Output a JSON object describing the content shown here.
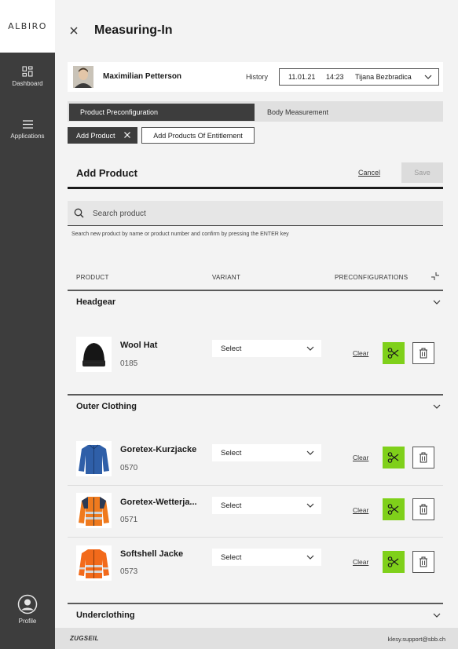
{
  "app": {
    "logo": "ALBIRO"
  },
  "sidebar": {
    "items": [
      {
        "label": "Dashboard",
        "icon": "dashboard-icon"
      },
      {
        "label": "Applications",
        "icon": "menu-icon"
      }
    ],
    "profile": {
      "label": "Profile",
      "icon": "profile-icon"
    }
  },
  "header": {
    "title": "Measuring-In",
    "close_icon": "close-icon"
  },
  "person": {
    "name": "Maximilian Petterson",
    "history_label": "History",
    "history": {
      "date": "11.01.21",
      "time": "14:23",
      "user": "Tijana Bezbradica"
    }
  },
  "tabs": [
    {
      "label": "Product Preconfiguration",
      "active": true
    },
    {
      "label": "Body Measurement",
      "active": false
    }
  ],
  "chips": {
    "add_product": "Add Product",
    "add_entitlement": "Add Products Of Entitlement"
  },
  "section": {
    "title": "Add Product",
    "cancel": "Cancel",
    "save": "Save"
  },
  "search": {
    "placeholder": "Search product",
    "hint": "Search new product by name or product number and confirm by pressing the ENTER key"
  },
  "columns": {
    "product": "PRODUCT",
    "variant": "VARIANT",
    "preconfigurations": "PRECONFIGURATIONS"
  },
  "categories": [
    {
      "name": "Headgear",
      "products": [
        {
          "name": "Wool Hat",
          "number": "0185",
          "variant": "Select",
          "clear": "Clear"
        }
      ]
    },
    {
      "name": "Outer Clothing",
      "products": [
        {
          "name": "Goretex-Kurzjacke",
          "number": "0570",
          "variant": "Select",
          "clear": "Clear"
        },
        {
          "name": "Goretex-Wetterja...",
          "number": "0571",
          "variant": "Select",
          "clear": "Clear"
        },
        {
          "name": "Softshell Jacke",
          "number": "0573",
          "variant": "Select",
          "clear": "Clear"
        }
      ]
    },
    {
      "name": "Underclothing",
      "products": []
    }
  ],
  "footer": {
    "logo": "ZUGSEIL",
    "email": "klesy.support@sbb.ch"
  },
  "colors": {
    "sidebar": "#3d3d3d",
    "accent": "#7fd01a",
    "background": "#f3f3f3"
  }
}
